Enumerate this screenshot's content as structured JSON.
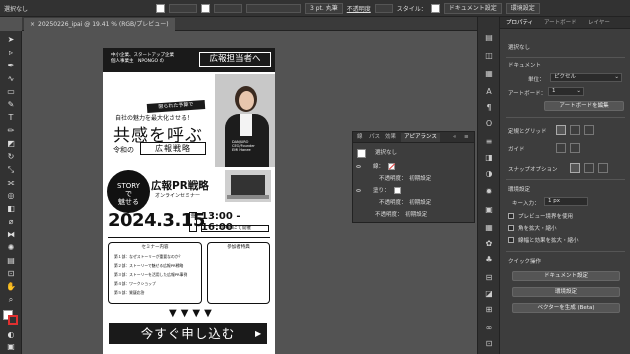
{
  "toolbar": {
    "selection_label": "選択なし",
    "stroke_size": "3 pt. 丸筆",
    "opacity_label": "不透明度",
    "style_label": "スタイル：",
    "doc_settings": "ドキュメント設定",
    "env_settings": "環境設定"
  },
  "document_tab": {
    "title": "20250226_ipai @ 19.41 % (RGB/プレビュー)"
  },
  "artboard": {
    "header_sub": "中小企業、スタートアップ企業\n個人事業主　NPONGO の",
    "header_title": "広報担当者へ",
    "photo_caption": "DANJURO\nCEO/Founder\nEMI Hanee",
    "badge": "限られた予算で",
    "line1": "自社の魅力を最大化させる！",
    "big_title": "共感を呼ぶ",
    "small_prefix": "令和の",
    "boxed": "広報戦略",
    "story_badge": "STORY\nで\n魅せる",
    "pr_title": "広報PR戦略",
    "pr_sub": "オンラインセミナー",
    "date": "2024.3.15",
    "weekday": "金",
    "time": "13:00 - 16:00",
    "zoom_note": "ZOOMにて開催",
    "program_title": "セミナー内容",
    "program_items": [
      "第１部：なぜストーリーが重要なのか？",
      "第２部：ストーリーで魅せる広報PR戦略",
      "第３部：ストーリーを活用した広報PR事例",
      "第４部：ワークショップ",
      "第５部：質疑応答"
    ],
    "bonus_title": "参加者特典",
    "arrows": "▼▼▼▼",
    "cta": "今すぐ申し込む",
    "cta_arrow": "▶"
  },
  "appearance_panel": {
    "tabs": [
      "線",
      "パス",
      "効果",
      "アピアランス"
    ],
    "active_tab": "アピアランス",
    "rows": [
      {
        "label": "選択なし"
      },
      {
        "label": "線："
      },
      {
        "label": "不透明度：　初期設定"
      },
      {
        "label": "塗り："
      },
      {
        "label": "不透明度：　初期設定"
      },
      {
        "label": "不透明度：　初期設定"
      }
    ]
  },
  "properties_panel": {
    "tabs": [
      "プロパティ",
      "アートボード",
      "レイヤー"
    ],
    "selection": "選択なし",
    "document_heading": "ドキュメント",
    "unit_label": "単位：",
    "unit_value": "ピクセル",
    "artboard_label": "アートボード：",
    "artboard_value": "1",
    "edit_artboard_button": "アートボードを編集",
    "ruler_grid_label": "定規とグリッド",
    "guide_label": "ガイド",
    "snap_label": "スナップオプション",
    "prefs_heading": "環境設定",
    "key_increment_label": "キー入力：",
    "key_increment_value": "1 px",
    "preview_bounds": "プレビュー境界を使用",
    "scale_corners": "角を拡大・縮小",
    "scale_strokes": "線幅と効果を拡大・縮小",
    "quick_actions_heading": "クイック操作",
    "doc_settings_button": "ドキュメント設定",
    "env_settings_button": "環境設定",
    "vector_button": "ベクターを生成 (Beta)"
  }
}
